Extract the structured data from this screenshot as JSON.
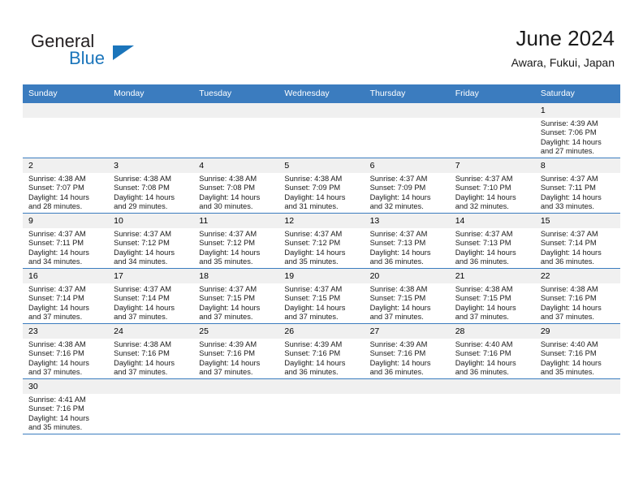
{
  "logo": {
    "word_one": "General",
    "word_two": "Blue",
    "accent_color": "#1b75bb",
    "triangle_icon": "logo-triangle-icon"
  },
  "header": {
    "month_title": "June 2024",
    "location": "Awara, Fukui, Japan"
  },
  "theme": {
    "header_blue": "#3b7cbf",
    "daynum_band": "#f0f0f0",
    "text": "#1a1a1a"
  },
  "calendar": {
    "weekday_headers": [
      "Sunday",
      "Monday",
      "Tuesday",
      "Wednesday",
      "Thursday",
      "Friday",
      "Saturday"
    ],
    "weeks": [
      [
        {
          "empty": true
        },
        {
          "empty": true
        },
        {
          "empty": true
        },
        {
          "empty": true
        },
        {
          "empty": true
        },
        {
          "empty": true
        },
        {
          "day": "1",
          "sunrise": "Sunrise: 4:39 AM",
          "sunset": "Sunset: 7:06 PM",
          "daylight1": "Daylight: 14 hours",
          "daylight2": "and 27 minutes."
        }
      ],
      [
        {
          "day": "2",
          "sunrise": "Sunrise: 4:38 AM",
          "sunset": "Sunset: 7:07 PM",
          "daylight1": "Daylight: 14 hours",
          "daylight2": "and 28 minutes."
        },
        {
          "day": "3",
          "sunrise": "Sunrise: 4:38 AM",
          "sunset": "Sunset: 7:08 PM",
          "daylight1": "Daylight: 14 hours",
          "daylight2": "and 29 minutes."
        },
        {
          "day": "4",
          "sunrise": "Sunrise: 4:38 AM",
          "sunset": "Sunset: 7:08 PM",
          "daylight1": "Daylight: 14 hours",
          "daylight2": "and 30 minutes."
        },
        {
          "day": "5",
          "sunrise": "Sunrise: 4:38 AM",
          "sunset": "Sunset: 7:09 PM",
          "daylight1": "Daylight: 14 hours",
          "daylight2": "and 31 minutes."
        },
        {
          "day": "6",
          "sunrise": "Sunrise: 4:37 AM",
          "sunset": "Sunset: 7:09 PM",
          "daylight1": "Daylight: 14 hours",
          "daylight2": "and 32 minutes."
        },
        {
          "day": "7",
          "sunrise": "Sunrise: 4:37 AM",
          "sunset": "Sunset: 7:10 PM",
          "daylight1": "Daylight: 14 hours",
          "daylight2": "and 32 minutes."
        },
        {
          "day": "8",
          "sunrise": "Sunrise: 4:37 AM",
          "sunset": "Sunset: 7:11 PM",
          "daylight1": "Daylight: 14 hours",
          "daylight2": "and 33 minutes."
        }
      ],
      [
        {
          "day": "9",
          "sunrise": "Sunrise: 4:37 AM",
          "sunset": "Sunset: 7:11 PM",
          "daylight1": "Daylight: 14 hours",
          "daylight2": "and 34 minutes."
        },
        {
          "day": "10",
          "sunrise": "Sunrise: 4:37 AM",
          "sunset": "Sunset: 7:12 PM",
          "daylight1": "Daylight: 14 hours",
          "daylight2": "and 34 minutes."
        },
        {
          "day": "11",
          "sunrise": "Sunrise: 4:37 AM",
          "sunset": "Sunset: 7:12 PM",
          "daylight1": "Daylight: 14 hours",
          "daylight2": "and 35 minutes."
        },
        {
          "day": "12",
          "sunrise": "Sunrise: 4:37 AM",
          "sunset": "Sunset: 7:12 PM",
          "daylight1": "Daylight: 14 hours",
          "daylight2": "and 35 minutes."
        },
        {
          "day": "13",
          "sunrise": "Sunrise: 4:37 AM",
          "sunset": "Sunset: 7:13 PM",
          "daylight1": "Daylight: 14 hours",
          "daylight2": "and 36 minutes."
        },
        {
          "day": "14",
          "sunrise": "Sunrise: 4:37 AM",
          "sunset": "Sunset: 7:13 PM",
          "daylight1": "Daylight: 14 hours",
          "daylight2": "and 36 minutes."
        },
        {
          "day": "15",
          "sunrise": "Sunrise: 4:37 AM",
          "sunset": "Sunset: 7:14 PM",
          "daylight1": "Daylight: 14 hours",
          "daylight2": "and 36 minutes."
        }
      ],
      [
        {
          "day": "16",
          "sunrise": "Sunrise: 4:37 AM",
          "sunset": "Sunset: 7:14 PM",
          "daylight1": "Daylight: 14 hours",
          "daylight2": "and 37 minutes."
        },
        {
          "day": "17",
          "sunrise": "Sunrise: 4:37 AM",
          "sunset": "Sunset: 7:14 PM",
          "daylight1": "Daylight: 14 hours",
          "daylight2": "and 37 minutes."
        },
        {
          "day": "18",
          "sunrise": "Sunrise: 4:37 AM",
          "sunset": "Sunset: 7:15 PM",
          "daylight1": "Daylight: 14 hours",
          "daylight2": "and 37 minutes."
        },
        {
          "day": "19",
          "sunrise": "Sunrise: 4:37 AM",
          "sunset": "Sunset: 7:15 PM",
          "daylight1": "Daylight: 14 hours",
          "daylight2": "and 37 minutes."
        },
        {
          "day": "20",
          "sunrise": "Sunrise: 4:38 AM",
          "sunset": "Sunset: 7:15 PM",
          "daylight1": "Daylight: 14 hours",
          "daylight2": "and 37 minutes."
        },
        {
          "day": "21",
          "sunrise": "Sunrise: 4:38 AM",
          "sunset": "Sunset: 7:15 PM",
          "daylight1": "Daylight: 14 hours",
          "daylight2": "and 37 minutes."
        },
        {
          "day": "22",
          "sunrise": "Sunrise: 4:38 AM",
          "sunset": "Sunset: 7:16 PM",
          "daylight1": "Daylight: 14 hours",
          "daylight2": "and 37 minutes."
        }
      ],
      [
        {
          "day": "23",
          "sunrise": "Sunrise: 4:38 AM",
          "sunset": "Sunset: 7:16 PM",
          "daylight1": "Daylight: 14 hours",
          "daylight2": "and 37 minutes."
        },
        {
          "day": "24",
          "sunrise": "Sunrise: 4:38 AM",
          "sunset": "Sunset: 7:16 PM",
          "daylight1": "Daylight: 14 hours",
          "daylight2": "and 37 minutes."
        },
        {
          "day": "25",
          "sunrise": "Sunrise: 4:39 AM",
          "sunset": "Sunset: 7:16 PM",
          "daylight1": "Daylight: 14 hours",
          "daylight2": "and 37 minutes."
        },
        {
          "day": "26",
          "sunrise": "Sunrise: 4:39 AM",
          "sunset": "Sunset: 7:16 PM",
          "daylight1": "Daylight: 14 hours",
          "daylight2": "and 36 minutes."
        },
        {
          "day": "27",
          "sunrise": "Sunrise: 4:39 AM",
          "sunset": "Sunset: 7:16 PM",
          "daylight1": "Daylight: 14 hours",
          "daylight2": "and 36 minutes."
        },
        {
          "day": "28",
          "sunrise": "Sunrise: 4:40 AM",
          "sunset": "Sunset: 7:16 PM",
          "daylight1": "Daylight: 14 hours",
          "daylight2": "and 36 minutes."
        },
        {
          "day": "29",
          "sunrise": "Sunrise: 4:40 AM",
          "sunset": "Sunset: 7:16 PM",
          "daylight1": "Daylight: 14 hours",
          "daylight2": "and 35 minutes."
        }
      ],
      [
        {
          "day": "30",
          "sunrise": "Sunrise: 4:41 AM",
          "sunset": "Sunset: 7:16 PM",
          "daylight1": "Daylight: 14 hours",
          "daylight2": "and 35 minutes."
        },
        {
          "empty": true
        },
        {
          "empty": true
        },
        {
          "empty": true
        },
        {
          "empty": true
        },
        {
          "empty": true
        },
        {
          "empty": true
        }
      ]
    ]
  }
}
